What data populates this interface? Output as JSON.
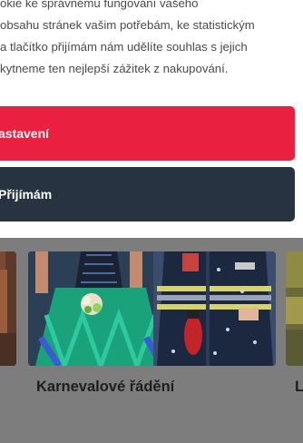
{
  "cookie_banner": {
    "text_lines": [
      "okie ke správnému fungování vašeho",
      "obsahu stránek vašim potřebám, ke statistickým",
      "a tlačítko přijímám nám udělíte souhlas s jejich",
      "kytneme ten nejlepší zážitek z nakupování."
    ],
    "settings_label": "astavení",
    "accept_label": "Přijímám"
  },
  "categories": {
    "main_title": "Karnevalové řádění",
    "right_title": "L"
  }
}
